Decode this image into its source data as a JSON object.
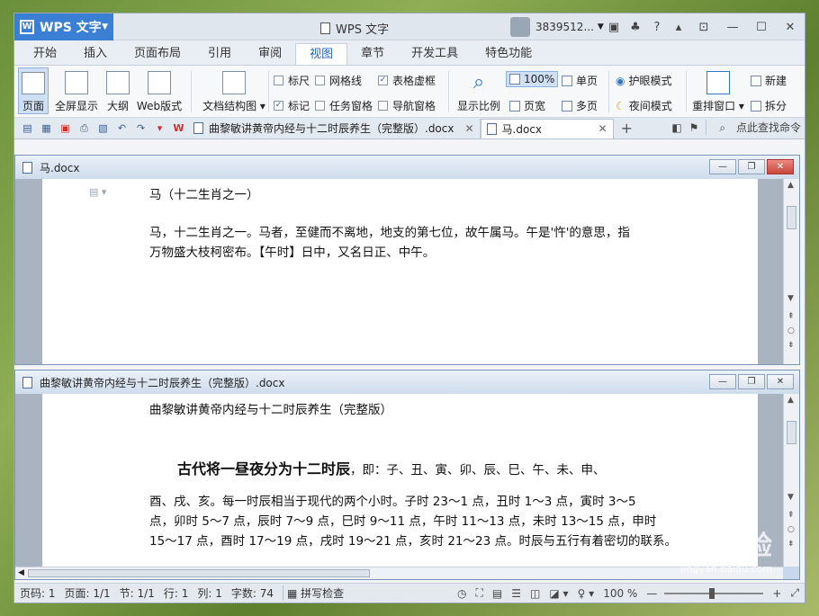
{
  "app": {
    "name": "WPS 文字",
    "window_title": "WPS 文字",
    "user": "3839512...",
    "top_icons": [
      "skin-icon",
      "shirt-icon",
      "help-icon",
      "minimize-ribbon-icon"
    ]
  },
  "menu": [
    "开始",
    "插入",
    "页面布局",
    "引用",
    "审阅",
    "视图",
    "章节",
    "开发工具",
    "特色功能"
  ],
  "ribbon": {
    "big_buttons": [
      {
        "label": "页面",
        "active": true
      },
      {
        "label": "全屏显示"
      },
      {
        "label": "大纲"
      },
      {
        "label": "Web版式"
      },
      {
        "label": "文档结构图"
      }
    ],
    "checks_row1": [
      {
        "label": "标尺",
        "checked": false
      },
      {
        "label": "网格线",
        "checked": false
      },
      {
        "label": "表格虚框",
        "checked": true
      }
    ],
    "checks_row2": [
      {
        "label": "标记",
        "checked": true
      },
      {
        "label": "任务窗格",
        "checked": false
      },
      {
        "label": "导航窗格",
        "checked": false
      }
    ],
    "zoom_label": "显示比例",
    "zoom_value": "100%",
    "single_page": "单页",
    "page_width": "页宽",
    "multi_page": "多页",
    "eye_mode": "护眼模式",
    "night_mode": "夜间模式",
    "rearrange": "重排窗口",
    "new_window": "新建",
    "split_window": "拆分"
  },
  "tabs": {
    "doc1": "曲黎敏讲黄帝内经与十二时辰养生（完整版）.docx",
    "doc2": "马.docx",
    "search_cmd": "点此查找命令"
  },
  "window1": {
    "title": "马.docx",
    "line1": "马（十二生肖之一）",
    "line2": "马，十二生肖之一。马者，至健而不离地，地支的第七位，故午属马。午是'忤'的意思，指",
    "line3": "万物盛大枝柯密布。【午时】日中，又名日正、中午。"
  },
  "window2": {
    "title": "曲黎敏讲黄帝内经与十二时辰养生（完整版）.docx",
    "line1": "曲黎敏讲黄帝内经与十二时辰养生（完整版）",
    "heading": "古代将一昼夜分为十二时辰",
    "heading_tail": "，即：子、丑、寅、卯、辰、巳、午、未、申、",
    "line3": "酉、戌、亥。每一时辰相当于现代的两个小时。子时 23～1 点，丑时 1～3 点，寅时 3～5",
    "line4": "点，卯时 5～7 点，辰时 7～9 点，巳时 9～11 点，午时 11～13 点，未时 13～15 点，申时",
    "line5": "15～17 点，酉时 17～19 点，戌时 19～21 点，亥时 21～23 点。时辰与五行有着密切的联系。"
  },
  "status": {
    "page_no": "页码: 1",
    "pages": "页面: 1/1",
    "section": "节: 1/1",
    "row": "行: 1",
    "col": "列: 1",
    "words": "字数: 74",
    "spell": "拼写检查",
    "zoom": "100 %"
  },
  "watermark": {
    "brand": "Bai经验",
    "url": "jingyan.baidu.com"
  }
}
